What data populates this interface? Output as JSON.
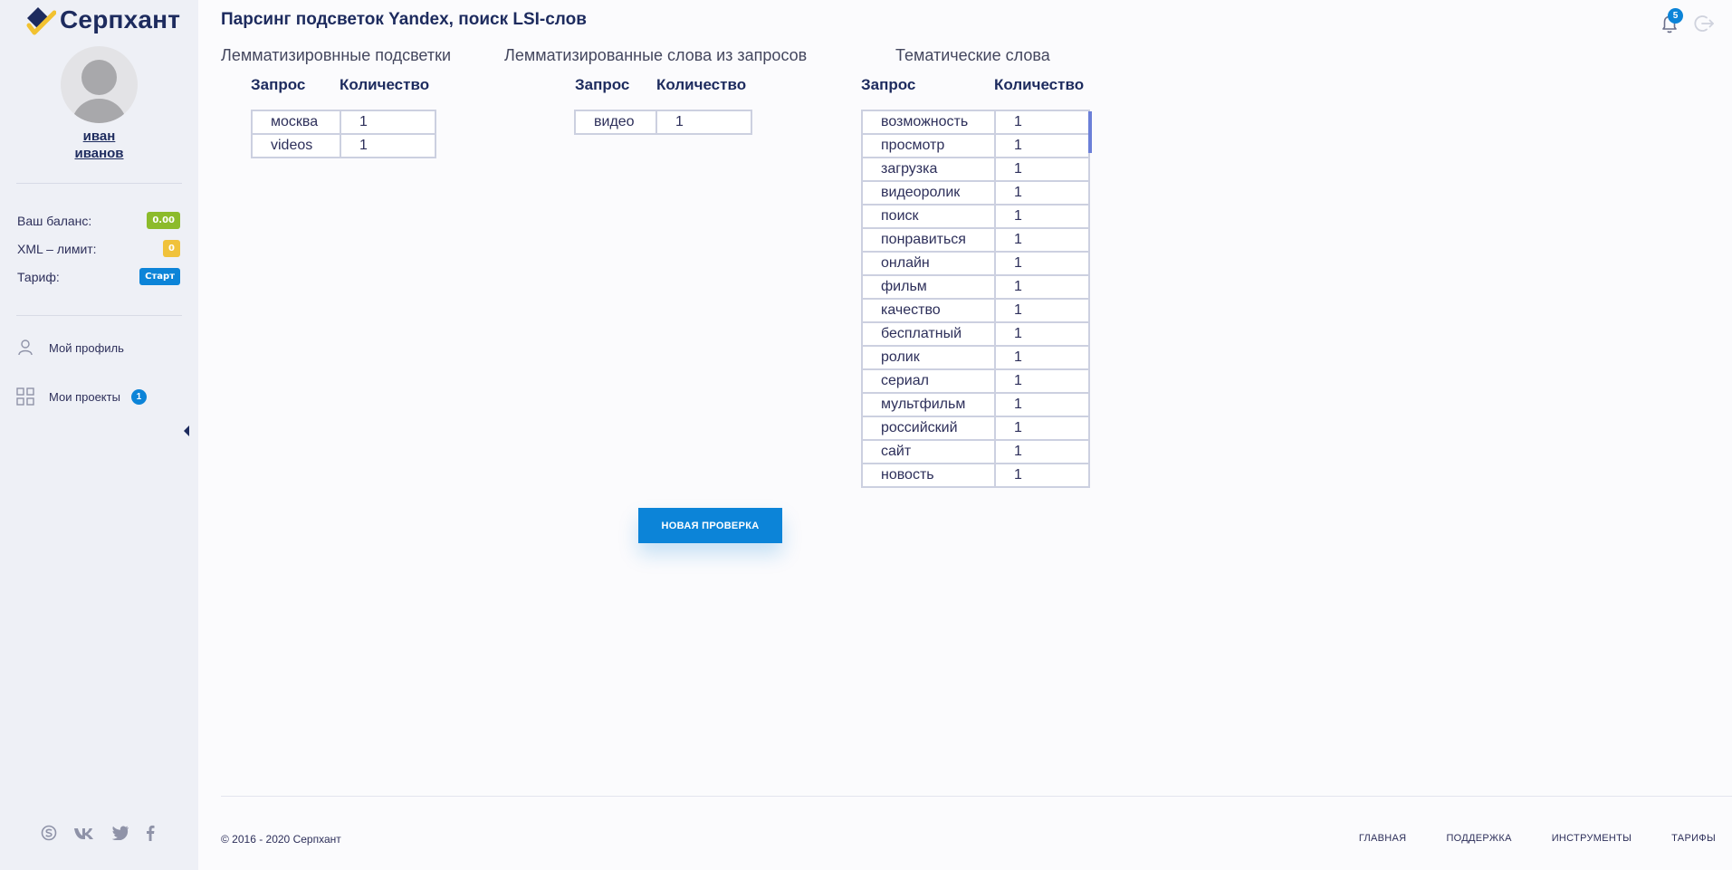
{
  "sidebar": {
    "logo_text": "Серпхант",
    "user_first": "иван",
    "user_last": "иванов",
    "stats": [
      {
        "label": "Ваш баланс:",
        "value": "0.00"
      },
      {
        "label": "XML – лимит:",
        "value": "0"
      },
      {
        "label": "Тариф:",
        "value": "Старт"
      }
    ],
    "nav": [
      {
        "label": "Мой профиль",
        "icon": "user-icon"
      },
      {
        "label": "Мои проекты",
        "icon": "grid-icon",
        "count": "1"
      }
    ],
    "socials": [
      "skype-icon",
      "vk-icon",
      "twitter-icon",
      "facebook-icon"
    ]
  },
  "header": {
    "title": "Парсинг подсветок Yandex, поиск LSI-слов",
    "notification_count": "5"
  },
  "sections": [
    {
      "title": "Лемматизировнные подсветки",
      "col_query": "Запрос",
      "col_count": "Количество",
      "rows": [
        {
          "query": "москва",
          "count": "1"
        },
        {
          "query": "videos",
          "count": "1"
        }
      ]
    },
    {
      "title": "Лемматизированные слова из запросов",
      "col_query": "Запрос",
      "col_count": "Количество",
      "rows": [
        {
          "query": "видео",
          "count": "1"
        }
      ]
    },
    {
      "title": "Тематические слова",
      "col_query": "Запрос",
      "col_count": "Количество",
      "rows": [
        {
          "query": "возможность",
          "count": "1"
        },
        {
          "query": "просмотр",
          "count": "1"
        },
        {
          "query": "загрузка",
          "count": "1"
        },
        {
          "query": "видеоролик",
          "count": "1"
        },
        {
          "query": "поиск",
          "count": "1"
        },
        {
          "query": "понравиться",
          "count": "1"
        },
        {
          "query": "онлайн",
          "count": "1"
        },
        {
          "query": "фильм",
          "count": "1"
        },
        {
          "query": "качество",
          "count": "1"
        },
        {
          "query": "бесплатный",
          "count": "1"
        },
        {
          "query": "ролик",
          "count": "1"
        },
        {
          "query": "сериал",
          "count": "1"
        },
        {
          "query": "мультфильм",
          "count": "1"
        },
        {
          "query": "российский",
          "count": "1"
        },
        {
          "query": "сайт",
          "count": "1"
        },
        {
          "query": "новость",
          "count": "1"
        }
      ]
    }
  ],
  "new_check_label": "НОВАЯ ПРОВЕРКА",
  "footer": {
    "copyright": "© 2016 - 2020 Серпхант",
    "links": [
      "ГЛАВНАЯ",
      "ПОДДЕРЖКА",
      "ИНСТРУМЕНТЫ",
      "ТАРИФЫ"
    ]
  },
  "colors": {
    "brand_dark": "#1d2b5e",
    "accent_blue": "#0c84d8",
    "badge_green": "#8cbb2b",
    "badge_yellow": "#f0c23b",
    "logo_yellow": "#f2c230"
  }
}
